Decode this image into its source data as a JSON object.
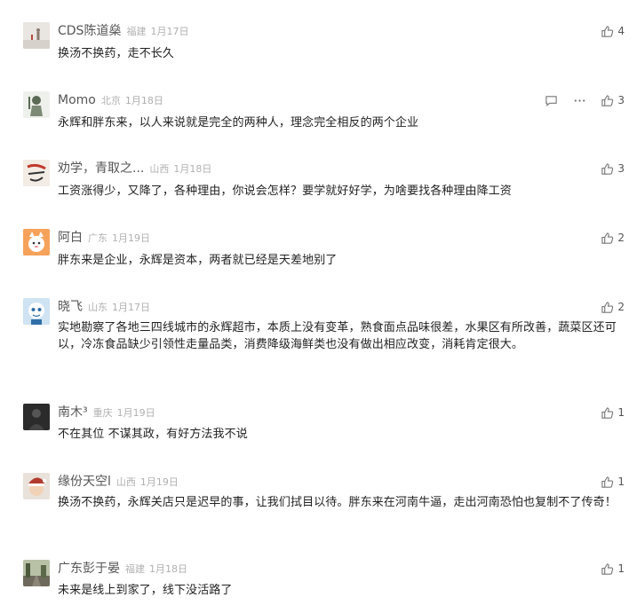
{
  "comments": [
    {
      "username": "CDS陈道燊",
      "region": "福建",
      "date": "1月17日",
      "text": "换汤不换药，走不长久",
      "likes": "4",
      "avatar": {
        "bg": "#e9e6e2",
        "fg": "#8a7b6f",
        "icon": "person-standing-avatar"
      }
    },
    {
      "username": "Momo",
      "region": "北京",
      "date": "1月18日",
      "text": "永辉和胖东来，以人来说就是完全的两种人，理念完全相反的两个企业",
      "likes": "3",
      "avatar": {
        "bg": "#d9dcd6",
        "fg": "#5b6a55",
        "icon": "knight-avatar"
      }
    },
    {
      "username": "劝学，青取之...",
      "region": "山西",
      "date": "1月18日",
      "text": "工资涨得少，又降了，各种理由，你说会怎样？要学就好好学，为啥要找各种理由降工资",
      "likes": "3",
      "avatar": {
        "bg": "#f3ece4",
        "fg": "#c0392b",
        "icon": "calligraphy-avatar"
      }
    },
    {
      "username": "阿白",
      "region": "广东",
      "date": "1月19日",
      "text": "胖东来是企业，永辉是资本，两者就已经是天差地别了",
      "likes": "2",
      "avatar": {
        "bg": "#f6a25b",
        "fg": "#ffffff",
        "icon": "cat-face-avatar"
      }
    },
    {
      "username": "晓飞",
      "region": "山东",
      "date": "1月17日",
      "text": "实地勘察了各地三四线城市的永辉超市，本质上没有变革，熟食面点品味很差，水果区有所改善，蔬菜区还可以，冷冻食品缺少引领性走量品类，消费降级海鲜类也没有做出相应改变，消耗肯定很大。",
      "likes": "2",
      "avatar": {
        "bg": "#cfe3f2",
        "fg": "#2f6fa8",
        "icon": "cartoon-avatar"
      }
    },
    {
      "username": "南木³",
      "region": "重庆",
      "date": "1月19日",
      "text": "不在其位 不谋其政，有好方法我不说",
      "likes": "1",
      "avatar": {
        "bg": "#2b2b2b",
        "fg": "#7a7a7a",
        "icon": "dark-silhouette-avatar"
      }
    },
    {
      "username": "缘份天空l",
      "region": "山西",
      "date": "1月19日",
      "text": "换汤不换药，永辉关店只是迟早的事，让我们拭目以待。胖东来在河南牛逼，走出河南恐怕也复制不了传奇！",
      "likes": "1",
      "avatar": {
        "bg": "#e8e2da",
        "fg": "#b23a2e",
        "icon": "santa-hat-avatar"
      }
    },
    {
      "username": "广东彭于晏",
      "region": "福建",
      "date": "1月18日",
      "text": "未来是线上到家了，线下没活路了",
      "likes": "1",
      "avatar": {
        "bg": "#9aa38a",
        "fg": "#4d5a3c",
        "icon": "street-photo-avatar"
      }
    }
  ],
  "icons": {
    "like": "thumbs-up-icon",
    "reply": "reply-bubble-icon",
    "more": "more-dots-icon"
  }
}
